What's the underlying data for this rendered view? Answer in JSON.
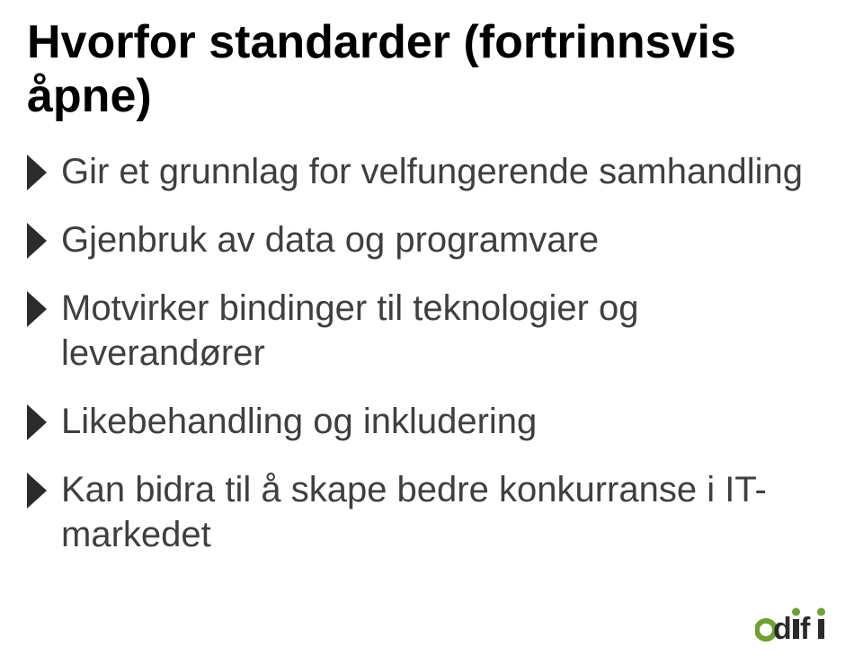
{
  "title": "Hvorfor standarder (fortrinnsvis åpne)",
  "bullets": [
    "Gir et grunnlag for velfungerende samhandling",
    "Gjenbruk av data og programvare",
    "Motvirker bindinger til teknologier og leverandører",
    "Likebehandling og inkludering",
    "Kan bidra til å skape bedre konkurranse i IT-markedet"
  ],
  "logo_text": "difi",
  "colors": {
    "bullet_icon": "#2b2b2b",
    "bullet_text": "#3f3f3f",
    "logo_accent": "#6da22f",
    "logo_text": "#2b2b2b"
  }
}
